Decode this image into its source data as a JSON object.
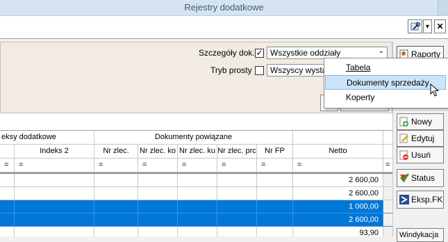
{
  "window": {
    "title": "Rejestry dodatkowe"
  },
  "toolbar": {
    "menu_arrow": "▾",
    "close": "✕"
  },
  "filter": {
    "details_label": "Szczegóły dok.",
    "details_checked": "✓",
    "branches_value": "Wszystkie oddziały",
    "simple_mode_label": "Tryb prosty",
    "warehouses_value": "Wszyscy wystaw"
  },
  "popup": {
    "items": [
      {
        "label": "Tabela"
      },
      {
        "label": "Dokumenty sprzedaży"
      },
      {
        "label": "Koperty"
      }
    ]
  },
  "actions": {
    "report_label": "Raporty",
    "new_label": "Nowy",
    "edit_label": "Edytuj",
    "delete_label": "Usuń",
    "status_label": "Status",
    "export_label": "Eksp.FK",
    "bottom_label": "Windykacja"
  },
  "grid": {
    "group_left": "eksy dodatkowe",
    "group_right": "Dokumenty powiązane",
    "columns": [
      "Indeks 2",
      "Nr zlec.",
      "Nr zlec. ko",
      "Nr zlec. ku",
      "Nr zlec. prc",
      "Nr FP",
      "Netto"
    ],
    "filter_symbol": "=",
    "rows": [
      {
        "netto": "2 600,00"
      },
      {
        "netto": "2 600,00"
      },
      {
        "netto": "1 000,00"
      },
      {
        "netto": "2 600,00"
      },
      {
        "netto": "93,90"
      }
    ]
  },
  "colors": {
    "selection": "#0078d7",
    "titlebar": "#d6e4f2",
    "panel": "#f1ebe4"
  }
}
